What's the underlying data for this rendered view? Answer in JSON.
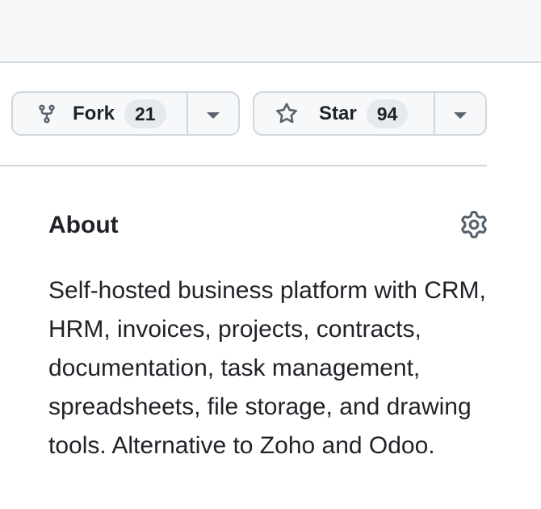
{
  "repo_actions": {
    "fork": {
      "label": "Fork",
      "count": "21"
    },
    "star": {
      "label": "Star",
      "count": "94"
    }
  },
  "about": {
    "title": "About",
    "description": "Self-hosted business platform with CRM, HRM, invoices, projects, contracts, documentation, task management, spreadsheets, file storage, and drawing tools. Alternative to Zoho and Odoo."
  },
  "icons": {
    "fork": "repo-forked-icon",
    "star": "star-icon",
    "settings": "gear-icon",
    "dropdown": "triangle-down-icon"
  }
}
